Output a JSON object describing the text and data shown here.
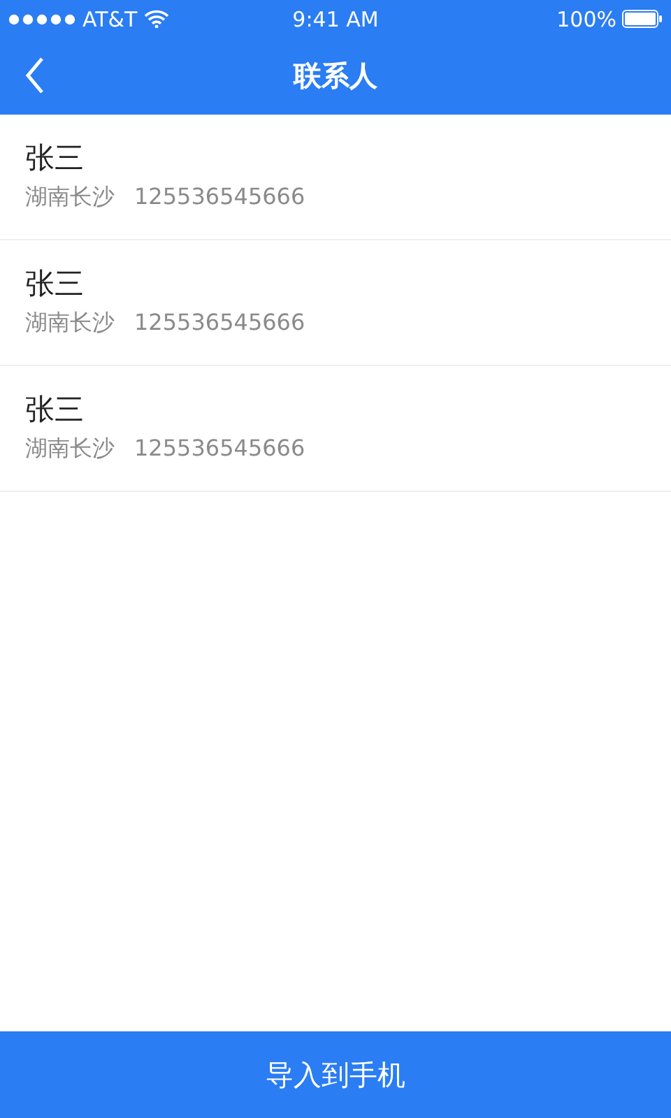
{
  "status_bar": {
    "carrier": "AT&T",
    "time": "9:41 AM",
    "battery": "100%"
  },
  "nav_bar": {
    "title": "联系人"
  },
  "contacts": [
    {
      "name": "张三",
      "location": "湖南长沙",
      "phone": "125536545666"
    },
    {
      "name": "张三",
      "location": "湖南长沙",
      "phone": "125536545666"
    },
    {
      "name": "张三",
      "location": "湖南长沙",
      "phone": "125536545666"
    }
  ],
  "bottom_button": "导入到手机"
}
